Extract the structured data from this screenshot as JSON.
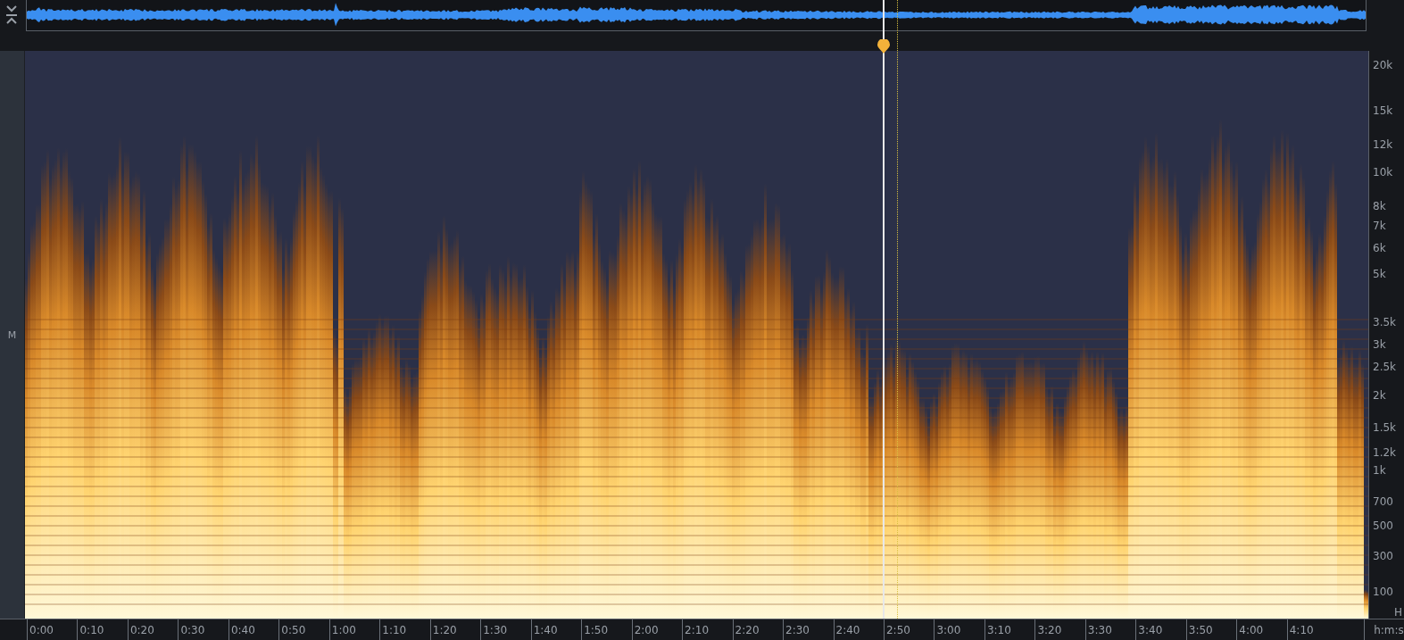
{
  "channel": {
    "label": "M"
  },
  "frequency_axis": {
    "labels": [
      "20k",
      "15k",
      "12k",
      "10k",
      "8k",
      "7k",
      "6k",
      "5k",
      "3.5k",
      "3k",
      "2.5k",
      "2k",
      "1.5k",
      "1.2k",
      "1k",
      "700",
      "500",
      "300",
      "100"
    ],
    "unit": "H"
  },
  "time_axis": {
    "labels": [
      "0:00",
      "0:10",
      "0:20",
      "0:30",
      "0:40",
      "0:50",
      "1:00",
      "1:10",
      "1:20",
      "1:30",
      "1:40",
      "1:50",
      "2:00",
      "2:10",
      "2:20",
      "2:30",
      "2:40",
      "2:50",
      "3:00",
      "3:10",
      "3:20",
      "3:30",
      "3:40",
      "3:50",
      "4:00",
      "4:10"
    ],
    "unit": "h:m:s"
  }
}
